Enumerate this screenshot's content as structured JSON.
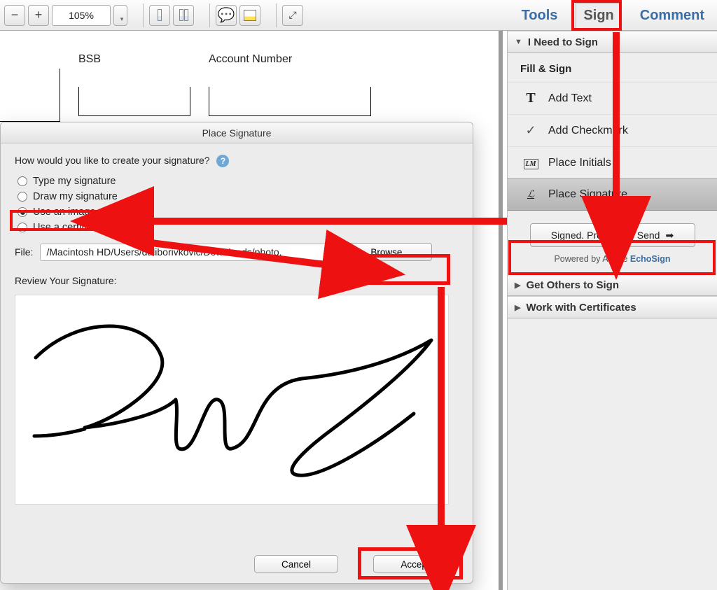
{
  "toolbar": {
    "zoom": "105%"
  },
  "top_tabs": {
    "tools": "Tools",
    "sign": "Sign",
    "comment": "Comment"
  },
  "document": {
    "field_bsb": "BSB",
    "field_account": "Account Number"
  },
  "right_panel": {
    "need_to_sign": "I Need to Sign",
    "fill_sign_label": "Fill & Sign",
    "add_text": "Add Text",
    "add_checkmark": "Add Checkmark",
    "place_initials": "Place Initials",
    "place_signature": "Place Signature",
    "proceed": "Signed. Proceed to Send",
    "powered_prefix": "Powered by Adobe ",
    "powered_link": "EchoSign",
    "get_others": "Get Others to Sign",
    "work_certs": "Work with Certificates"
  },
  "dialog": {
    "title": "Place Signature",
    "prompt": "How would you like to create your signature?",
    "opt_type": "Type my signature",
    "opt_draw": "Draw my signature",
    "opt_image": "Use an image",
    "opt_cert": "Use a certificate",
    "file_label": "File:",
    "file_value": "/Macintosh HD/Users/daliborivkovic/Downloads/photo.",
    "browse": "Browse...",
    "review_label": "Review Your Signature:",
    "cancel": "Cancel",
    "accept": "Accept"
  }
}
